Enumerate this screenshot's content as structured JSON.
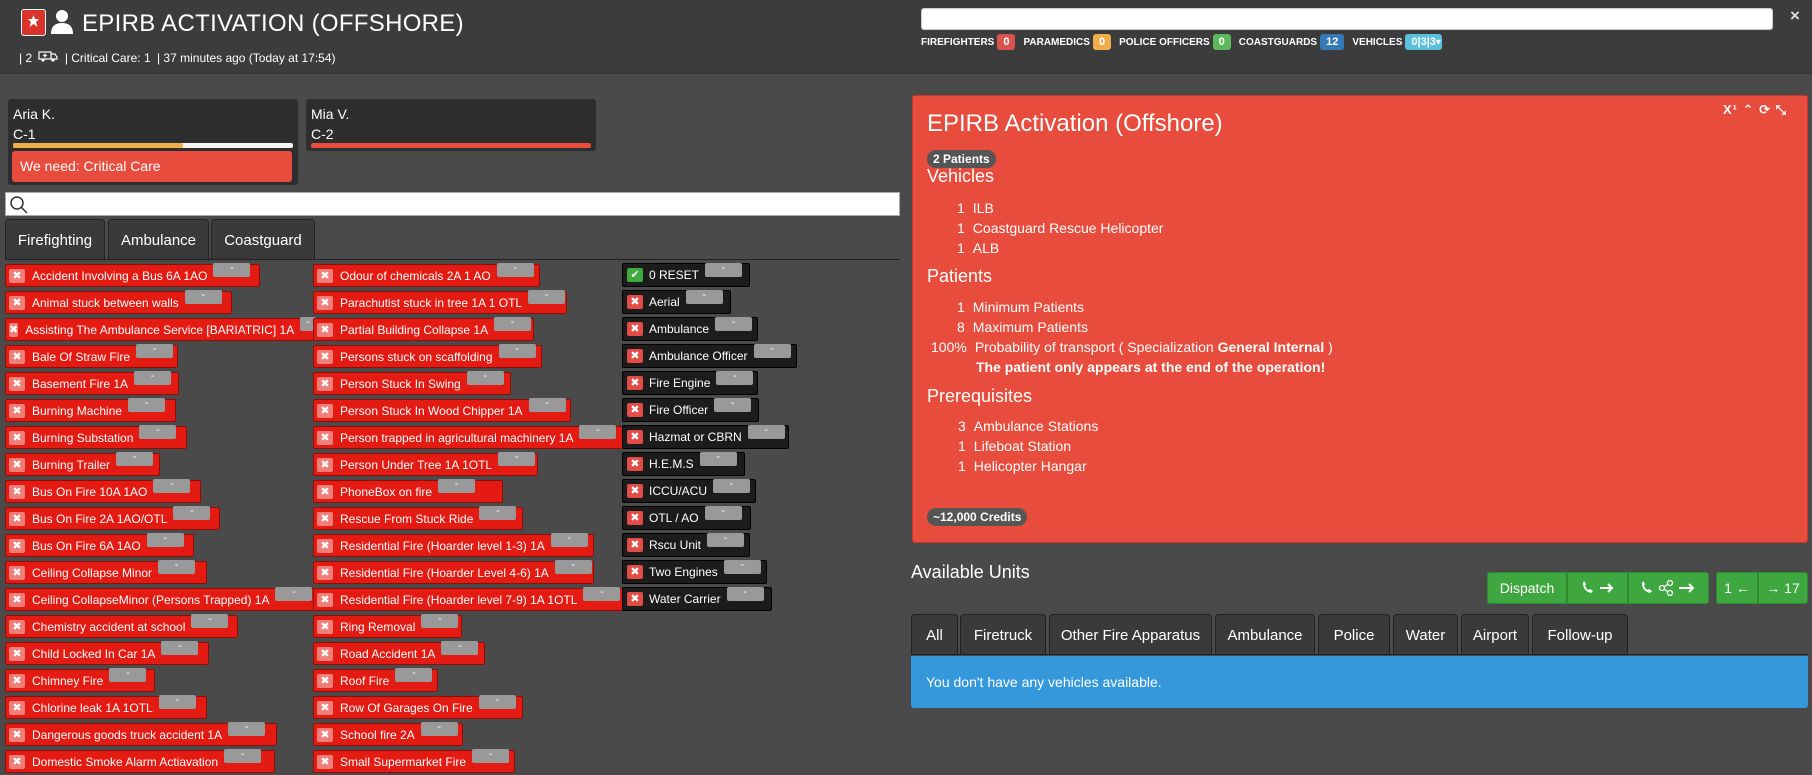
{
  "header": {
    "title": "EPIRB ACTIVATION (OFFSHORE)",
    "patients_count": "| 2",
    "critical_care": "| Critical Care: 1",
    "time_ago": "| 37 minutes ago (Today at 17:54)",
    "close_label": "×",
    "counters": [
      {
        "label": "FIREFIGHTERS",
        "value": "0",
        "color": "#d9534f"
      },
      {
        "label": "PARAMEDICS",
        "value": "0",
        "color": "#f0ad4e"
      },
      {
        "label": "POLICE OFFICERS",
        "value": "0",
        "color": "#5cb85c"
      },
      {
        "label": "COASTGUARDS",
        "value": "12",
        "color": "#337ab7"
      },
      {
        "label": "VEHICLES",
        "value": "0|3|3",
        "color": "#5bc0de"
      }
    ]
  },
  "crew": [
    {
      "name": "Aria K.",
      "code": "C-1",
      "need": "We need: Critical Care"
    },
    {
      "name": "Mia V.",
      "code": "C-2"
    }
  ],
  "call_tabs": [
    "Firefighting",
    "Ambulance",
    "Coastguard"
  ],
  "calls_col1": [
    "Accident Involving a Bus 6A 1AO",
    "Animal stuck between walls",
    "Assisting The Ambulance Service [BARIATRIC] 1A",
    "Bale Of Straw Fire",
    "Basement Fire 1A",
    "Burning Machine",
    "Burning Substation",
    "Burning Trailer",
    "Bus On Fire 10A 1AO",
    "Bus On Fire 2A 1AO/OTL",
    "Bus On Fire 6A 1AO",
    "Ceiling Collapse Minor",
    "Ceiling CollapseMinor (Persons Trapped) 1A",
    "Chemistry accident at school",
    "Child Locked In Car 1A",
    "Chimney Fire",
    "Chlorine leak 1A 1OTL",
    "Dangerous goods truck accident 1A",
    "Domestic Smoke Alarm Actiavation"
  ],
  "calls_col2": [
    "Odour of chemicals 2A 1 AO",
    "Parachutist stuck in tree 1A 1 OTL",
    "Partial Building Collapse 1A",
    "Persons stuck on scaffolding",
    "Person Stuck In Swing",
    "Person Stuck In Wood Chipper 1A",
    "Person trapped in agricultural machinery 1A",
    "Person Under Tree 1A 1OTL",
    "PhoneBox on fire",
    "Rescue From Stuck Ride",
    "Residential Fire (Hoarder level 1-3) 1A",
    "Residential Fire (Hoarder Level 4-6) 1A",
    "Residential Fire (Hoarder level 7-9) 1A 1OTL",
    "Ring Removal",
    "Road Accident 1A",
    "Roof Fire",
    "Row Of Garages On Fire",
    "School fire 2A",
    "Small Supermarket Fire"
  ],
  "vehicle_filters": [
    "0 RESET",
    "Aerial",
    "Ambulance",
    "Ambulance Officer",
    "Fire Engine",
    "Fire Officer",
    "Hazmat or CBRN",
    "H.E.M.S",
    "ICCU/ACU",
    "OTL / AO",
    "Rscu Unit",
    "Two Engines",
    "Water Carrier"
  ],
  "minus_label": "-",
  "mission": {
    "title": "EPIRB Activation (Offshore)",
    "patients_badge": "2 Patients",
    "tools": "X¹ ⌃ ⟳ ⤡",
    "vehicles_heading": "Vehicles",
    "vehicles": [
      {
        "qty": "1",
        "name": "ILB"
      },
      {
        "qty": "1",
        "name": "Coastguard Rescue Helicopter"
      },
      {
        "qty": "1",
        "name": "ALB"
      }
    ],
    "patients_heading": "Patients",
    "patients": [
      {
        "qty": "1",
        "name": "Minimum Patients"
      },
      {
        "qty": "8",
        "name": "Maximum Patients"
      },
      {
        "qty": "100%",
        "name": "Probability of transport ( Specialization ",
        "bold": "General Internal",
        "tail": " )"
      }
    ],
    "patients_note": "The patient only appears at the end of the operation!",
    "prereq_heading": "Prerequisites",
    "prereqs": [
      {
        "qty": "3",
        "name": "Ambulance Stations"
      },
      {
        "qty": "1",
        "name": "Lifeboat Station"
      },
      {
        "qty": "1",
        "name": "Helicopter Hangar"
      }
    ],
    "credits": "~12,000 Credits"
  },
  "units": {
    "title": "Available Units",
    "dispatch_label": "Dispatch",
    "nav_left": "1 ←",
    "nav_right": "→ 17",
    "tabs": [
      "All",
      "Firetruck",
      "Other Fire Apparatus",
      "Ambulance",
      "Police",
      "Water",
      "Airport",
      "Follow-up"
    ],
    "empty_message": "You don't have any vehicles available."
  },
  "colors": {
    "accent_red": "#e74c3c",
    "call_red": "#e31b13",
    "info_blue": "#3498db",
    "dispatch_green": "#3fa73f"
  }
}
